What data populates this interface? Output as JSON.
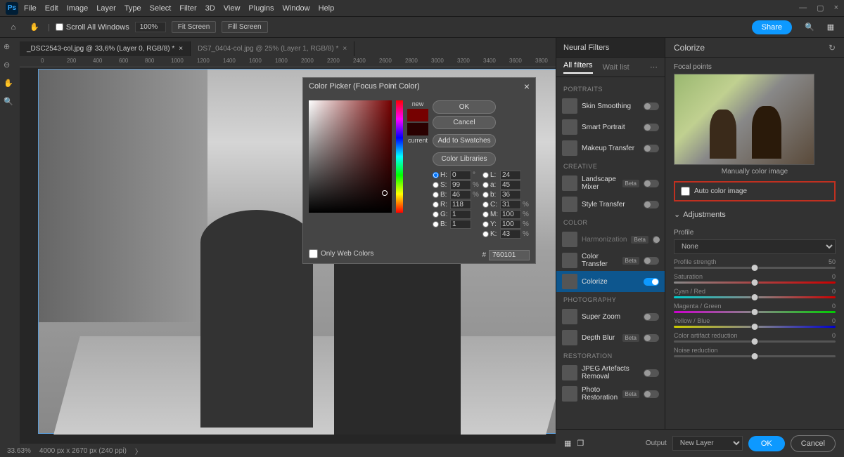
{
  "menu": [
    "File",
    "Edit",
    "Image",
    "Layer",
    "Type",
    "Select",
    "Filter",
    "3D",
    "View",
    "Plugins",
    "Window",
    "Help"
  ],
  "optbar": {
    "scroll": "Scroll All Windows",
    "zoom": "100%",
    "fit": "Fit Screen",
    "fill": "Fill Screen",
    "share": "Share"
  },
  "tabs": [
    {
      "label": "_DSC2543-col.jpg @ 33,6% (Layer 0, RGB/8) *",
      "close": "×"
    },
    {
      "label": "DS7_0404-col.jpg @ 25% (Layer 1, RGB/8) *",
      "close": "×"
    }
  ],
  "dialog": {
    "title": "Color Picker (Focus Point Color)",
    "ok": "OK",
    "cancel": "Cancel",
    "add": "Add to Swatches",
    "lib": "Color Libraries",
    "new": "new",
    "current": "current",
    "onlyweb": "Only Web Colors",
    "hexprefix": "#",
    "hex": "760101",
    "vals": {
      "H": "0",
      "S": "99",
      "B": "46",
      "R": "118",
      "G": "1",
      "Bb": "1",
      "L": "24",
      "a": "45",
      "b": "36",
      "C": "31",
      "M": "100",
      "Y": "100",
      "K": "43"
    }
  },
  "nf": {
    "title": "Neural Filters",
    "tabs": {
      "all": "All filters",
      "wait": "Wait list"
    },
    "cats": {
      "PORTRAITS": [
        {
          "n": "Skin Smoothing"
        },
        {
          "n": "Smart Portrait"
        },
        {
          "n": "Makeup Transfer"
        }
      ],
      "CREATIVE": [
        {
          "n": "Landscape Mixer",
          "beta": true
        },
        {
          "n": "Style Transfer"
        }
      ],
      "COLOR": [
        {
          "n": "Harmonization",
          "beta": true,
          "dis": true
        },
        {
          "n": "Color Transfer",
          "beta": true
        },
        {
          "n": "Colorize",
          "on": true,
          "active": true
        }
      ],
      "PHOTOGRAPHY": [
        {
          "n": "Super Zoom"
        },
        {
          "n": "Depth Blur",
          "beta": true
        }
      ],
      "RESTORATION": [
        {
          "n": "JPEG Artefacts Removal"
        },
        {
          "n": "Photo Restoration",
          "beta": true
        }
      ]
    }
  },
  "col": {
    "title": "Colorize",
    "focal": "Focal points",
    "manual": "Manually color image",
    "auto": "Auto color image",
    "adj": "Adjustments",
    "profile": "Profile",
    "none": "None",
    "pstrength": "Profile strength",
    "pval": "50",
    "sliders": [
      {
        "l": "Saturation",
        "v": "0",
        "cls": "grad-sat"
      },
      {
        "l": "Cyan / Red",
        "v": "0",
        "cls": "grad-cr"
      },
      {
        "l": "Magenta / Green",
        "v": "0",
        "cls": "grad-mg"
      },
      {
        "l": "Yellow / Blue",
        "v": "0",
        "cls": "grad-yb"
      },
      {
        "l": "Color artifact reduction",
        "v": "0",
        "cls": ""
      },
      {
        "l": "Noise reduction",
        "v": "",
        "cls": ""
      }
    ]
  },
  "footer": {
    "output": "Output",
    "newlayer": "New Layer",
    "ok": "OK",
    "cancel": "Cancel"
  },
  "status": {
    "zoom": "33.63%",
    "dim": "4000 px x 2670 px (240 ppi)"
  }
}
